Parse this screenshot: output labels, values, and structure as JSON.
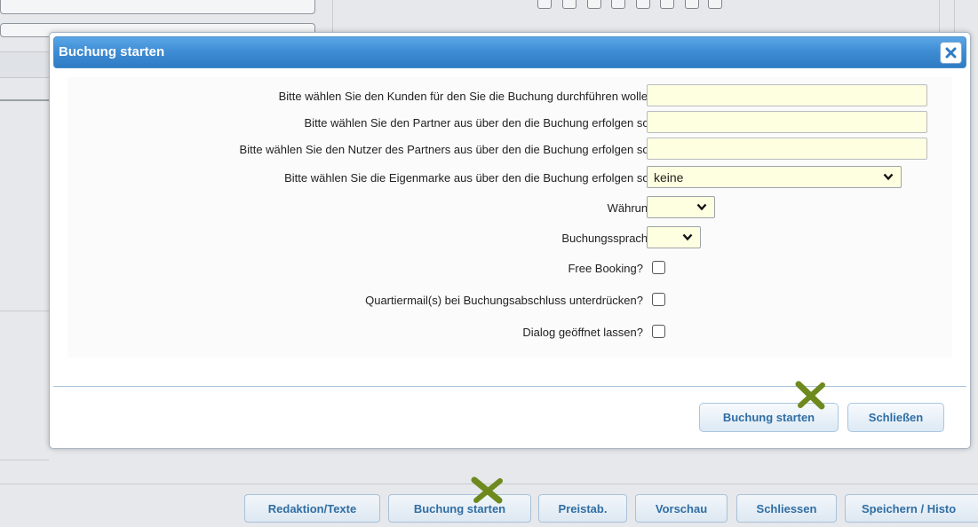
{
  "dialog": {
    "title": "Buchung starten",
    "fields": {
      "kunde_label": "Bitte wählen Sie den Kunden für den Sie die Buchung durchführen wollen:",
      "kunde_value": "",
      "partner_label": "Bitte wählen Sie den Partner aus über den die Buchung erfolgen soll:",
      "partner_value": "",
      "nutzer_label": "Bitte wählen Sie den Nutzer des Partners aus über den die Buchung erfolgen soll:",
      "nutzer_value": "",
      "eigenmarke_label": "Bitte wählen Sie die Eigenmarke aus über den die Buchung erfolgen soll:",
      "eigenmarke_value": "keine",
      "waehrung_label": "Währung:",
      "waehrung_value": "",
      "sprache_label": "Buchungssprache:",
      "sprache_value": "",
      "free_booking_label": "Free Booking?",
      "quartiermail_label": "Quartiermail(s) bei Buchungsabschluss unterdrücken?",
      "offen_label": "Dialog geöffnet lassen?"
    },
    "buttons": {
      "start": "Buchung starten",
      "close": "Schließen"
    }
  },
  "bottom_toolbar": {
    "buttons": [
      "Redaktion/Texte",
      "Buchung starten",
      "Preistab.",
      "Vorschau",
      "Schliessen",
      "Speichern / Histo"
    ]
  },
  "colors": {
    "titlebar": "#3d8bd3",
    "field_bg": "#fefee0",
    "button_text": "#2f6ea4",
    "marker": "#6e8a1f"
  },
  "icons": {
    "close": "close-x-icon",
    "dropdown": "chevron-down-icon",
    "marker": "cross-marker-icon"
  }
}
